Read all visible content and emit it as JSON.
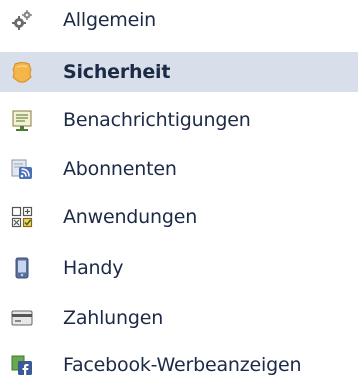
{
  "sidebar": {
    "items": [
      {
        "label": "Allgemein",
        "icon": "gears-icon",
        "selected": false
      },
      {
        "label": "Sicherheit",
        "icon": "shield-badge-icon",
        "selected": true
      },
      {
        "label": "Benachrichtigungen",
        "icon": "notice-board-icon",
        "selected": false
      },
      {
        "label": "Abonnenten",
        "icon": "rss-feed-icon",
        "selected": false
      },
      {
        "label": "Anwendungen",
        "icon": "apps-grid-icon",
        "selected": false
      },
      {
        "label": "Handy",
        "icon": "mobile-phone-icon",
        "selected": false
      },
      {
        "label": "Zahlungen",
        "icon": "credit-card-icon",
        "selected": false
      },
      {
        "label": "Facebook-Werbeanzeigen",
        "icon": "facebook-ads-icon",
        "selected": false
      }
    ]
  },
  "colors": {
    "selected_background": "#d8dfea",
    "text": "#1c2a47",
    "shield": "#f5b54a",
    "facebook_blue": "#3b5998"
  }
}
